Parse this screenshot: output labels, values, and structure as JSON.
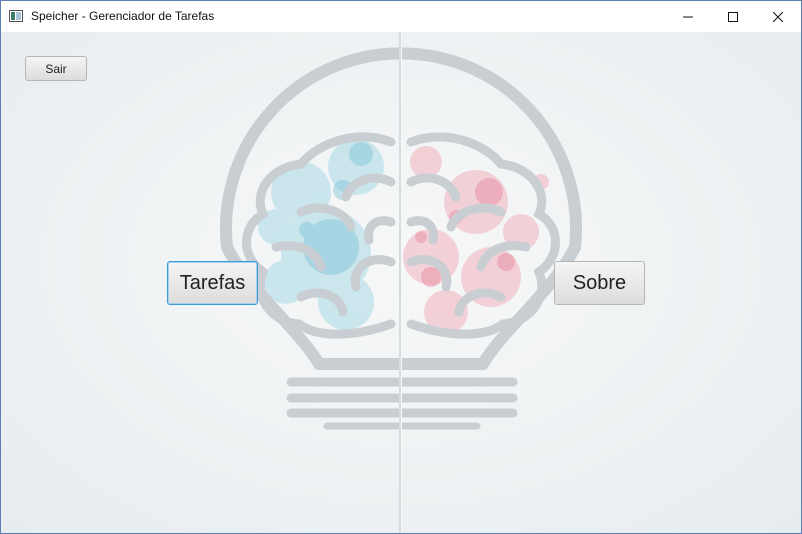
{
  "window": {
    "title": "Speicher - Gerenciador de Tarefas"
  },
  "icons": {
    "app": "app-icon",
    "minimize": "minimize-icon",
    "maximize": "maximize-icon",
    "close": "close-icon",
    "background": "brain-lightbulb-illustration"
  },
  "buttons": {
    "sair": "Sair",
    "tarefas": "Tarefas",
    "sobre": "Sobre"
  },
  "colors": {
    "window_border": "#5b7fb4",
    "focus_border": "#3e9bd6",
    "bulb_outline": "#c9ced2",
    "left_splash": "#a9d9e6",
    "right_splash": "#f2b8c3"
  }
}
